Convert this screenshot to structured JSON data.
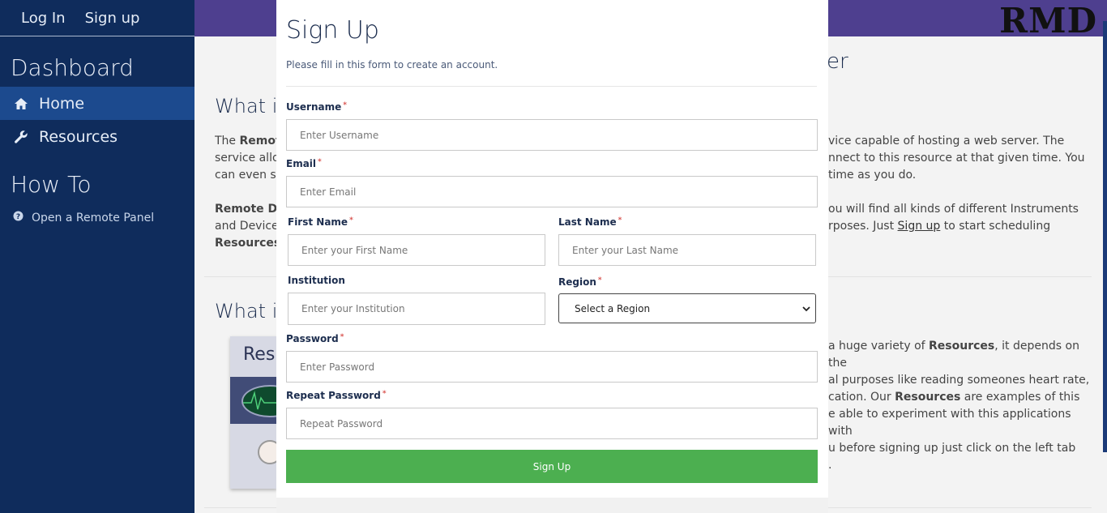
{
  "sidebar": {
    "auth": {
      "login": "Log In",
      "signup": "Sign up"
    },
    "dashboard_title": "Dashboard",
    "items": [
      {
        "label": "Home",
        "icon": "home-icon",
        "active": true
      },
      {
        "label": "Resources",
        "icon": "wrench-icon",
        "active": false
      }
    ],
    "howto_title": "How To",
    "howto_items": [
      {
        "label": "Open a Remote Panel",
        "icon": "question-circle-icon"
      }
    ]
  },
  "header": {
    "logo": "RMD"
  },
  "background": {
    "frag_title_1": "What is",
    "frag_title_right": "er",
    "frag_p1_l1_pre": "The ",
    "frag_p1_l1_bold": "Remote",
    "frag_p1_l2": "service allo",
    "frag_p1_l3": "can even sh",
    "frag_p2_l1": "Remote De",
    "frag_p2_l2": "and Device",
    "frag_p2_l3_bold": "Resources",
    "frag_p2_l3_post": ".",
    "right_p1_l1": "vice capable of hosting a web server. The",
    "right_p1_l2": "nnect to this resource at that given time. You",
    "right_p1_l3": "time as you do.",
    "right_p2_l1": "ou will find all kinds of different Instruments",
    "right_p2_l2_pre": "rposes. Just ",
    "right_p2_l2_link": "Sign up",
    "right_p2_l2_post": " to start scheduling",
    "frag_title_2": "What is",
    "card_title": "Res",
    "right_p3_l1_pre": "a huge variety of ",
    "right_p3_l1_bold": "Resources",
    "right_p3_l1_post": ", it depends on the",
    "right_p3_l2": "al purposes like reading someones heart rate,",
    "right_p3_l3_pre": "cation. Our ",
    "right_p3_l3_bold": "Resources",
    "right_p3_l3_post": " are examples of this",
    "right_p3_l4": "e able to experiment with this applications with",
    "right_p4_l1": "u before signing up just click on the left tab",
    "right_p4_l2": "."
  },
  "modal": {
    "title": "Sign Up",
    "subtitle": "Please fill in this form to create an account.",
    "username_label": "Username",
    "username_placeholder": "Enter Username",
    "email_label": "Email",
    "email_placeholder": "Enter Email",
    "first_name_label": "First Name",
    "first_name_placeholder": "Enter your First Name",
    "last_name_label": "Last Name",
    "last_name_placeholder": "Enter your Last Name",
    "institution_label": "Institution",
    "institution_placeholder": "Enter your Institution",
    "region_label": "Region",
    "region_selected": "Select a Region",
    "password_label": "Password",
    "password_placeholder": "Enter Password",
    "repeat_password_label": "Repeat Password",
    "repeat_password_placeholder": "Repeat Password",
    "required_mark": "*",
    "submit_label": "Sign Up"
  },
  "colors": {
    "sidebar_bg": "#0f2c5c",
    "sidebar_active": "#1c4a8e",
    "topbar": "#4e3f8f",
    "submit_bg": "#4caf50",
    "required": "#d9534f"
  }
}
